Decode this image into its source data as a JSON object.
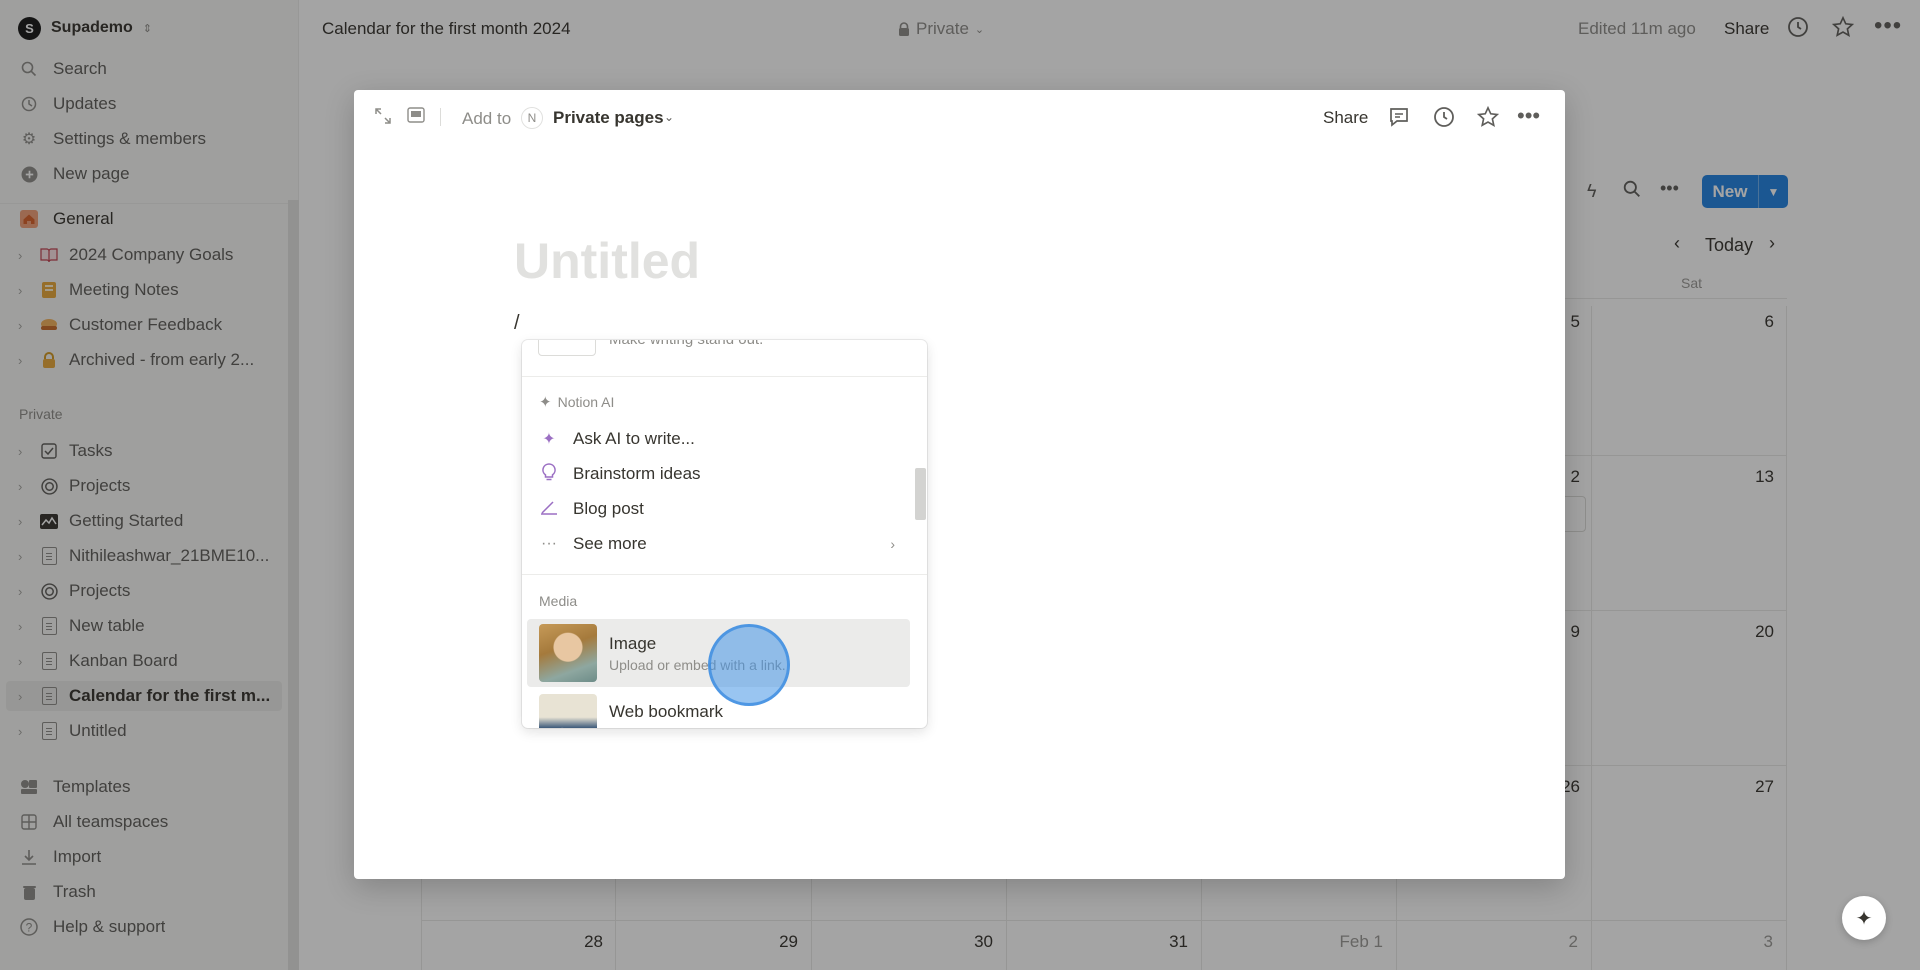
{
  "sidebar": {
    "workspace": {
      "name": "Supademo",
      "avatar_letter": "S"
    },
    "top_items": [
      {
        "label": "Search",
        "icon": "search-icon"
      },
      {
        "label": "Updates",
        "icon": "clock-icon"
      },
      {
        "label": "Settings & members",
        "icon": "gear-icon"
      },
      {
        "label": "New page",
        "icon": "plus-circle-icon"
      }
    ],
    "teamspace": {
      "label": "General",
      "icon": "home-icon"
    },
    "team_pages": [
      {
        "label": "2024 Company Goals",
        "icon": "book-icon"
      },
      {
        "label": "Meeting Notes",
        "icon": "notebook-icon"
      },
      {
        "label": "Customer Feedback",
        "icon": "food-icon"
      },
      {
        "label": "Archived - from early 2...",
        "icon": "lock-icon"
      }
    ],
    "private_heading": "Private",
    "private_pages": [
      {
        "label": "Tasks",
        "icon": "checkbox-icon"
      },
      {
        "label": "Projects",
        "icon": "target-icon"
      },
      {
        "label": "Getting Started",
        "icon": "chart-icon"
      },
      {
        "label": "Nithileashwar_21BME10...",
        "icon": "page-icon"
      },
      {
        "label": "Projects",
        "icon": "target-icon"
      },
      {
        "label": "New table",
        "icon": "page-icon"
      },
      {
        "label": "Kanban Board",
        "icon": "page-icon"
      },
      {
        "label": "Calendar for the first m...",
        "icon": "page-icon",
        "active": true
      },
      {
        "label": "Untitled",
        "icon": "page-icon"
      }
    ],
    "bottom_items": [
      {
        "label": "Templates",
        "icon": "templates-icon"
      },
      {
        "label": "All teamspaces",
        "icon": "grid-icon"
      },
      {
        "label": "Import",
        "icon": "import-icon"
      },
      {
        "label": "Trash",
        "icon": "trash-icon"
      },
      {
        "label": "Help & support",
        "icon": "help-icon"
      }
    ]
  },
  "topbar": {
    "title": "Calendar for the first month 2024",
    "privacy": "Private",
    "edited": "Edited 11m ago",
    "share": "Share"
  },
  "calendar": {
    "new_label": "New",
    "today_label": "Today",
    "day_of_week": "Sat",
    "week_numbers": [
      {
        "left": "5",
        "right": "6"
      },
      {
        "left": "2",
        "right": "13"
      },
      {
        "left": "9",
        "right": "20"
      },
      {
        "left": "26",
        "right": "27"
      }
    ],
    "last_row": [
      "28",
      "29",
      "30",
      "31",
      "Feb 1",
      "2",
      "3"
    ],
    "event_chip": "."
  },
  "modal": {
    "add_to": "Add to",
    "dest_avatar": "N",
    "destination": "Private pages",
    "share": "Share",
    "title_placeholder": "Untitled",
    "slash": "/"
  },
  "menu": {
    "cut_text": "Make writing stand out.",
    "ai_section": "Notion AI",
    "ai_items": [
      {
        "label": "Ask AI to write...",
        "icon": "sparkle-icon"
      },
      {
        "label": "Brainstorm ideas",
        "icon": "lightbulb-icon"
      },
      {
        "label": "Blog post",
        "icon": "pen-icon"
      },
      {
        "label": "See more",
        "icon": "more-icon"
      }
    ],
    "media_section": "Media",
    "media_items": [
      {
        "title": "Image",
        "subtitle": "Upload or embed with a link."
      },
      {
        "title": "Web bookmark",
        "subtitle": ""
      }
    ]
  },
  "colors": {
    "accent": "#2383e2",
    "ai_purple": "#9b6fc3",
    "hover": "#ebebea"
  }
}
